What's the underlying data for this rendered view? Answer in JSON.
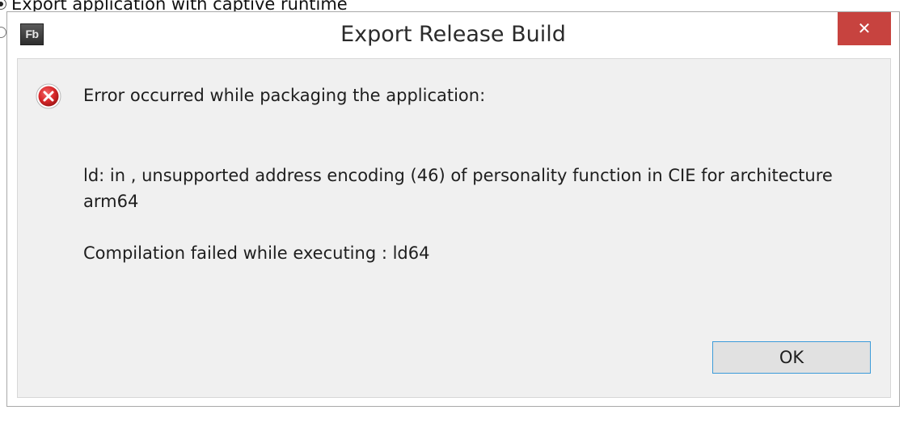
{
  "background": {
    "option_label": "Export application with captive runtime"
  },
  "dialog": {
    "app_icon_text": "Fb",
    "title": "Export Release Build",
    "close_glyph": "✕",
    "icons": {
      "app": "flash-builder-icon",
      "error": "error-icon",
      "close": "close-icon"
    },
    "colors": {
      "close_button": "#c7433f",
      "error_red": "#d9292b",
      "ok_border": "#3c9bd9"
    },
    "message": {
      "headline": "Error occurred while packaging the application:",
      "detail_line1": "ld: in , unsupported address encoding (46) of personality function in CIE for architecture arm64",
      "detail_line2": "Compilation failed while executing : ld64"
    },
    "ok_label": "OK"
  }
}
